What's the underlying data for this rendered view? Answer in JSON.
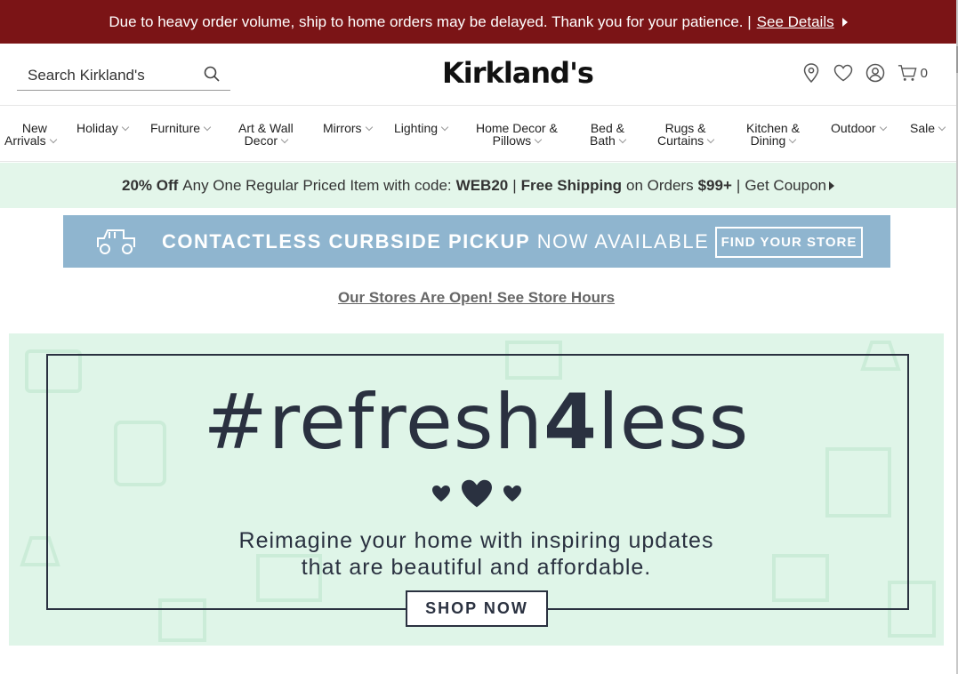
{
  "announcement": {
    "text": "Due to heavy order volume, ship to home orders may be delayed. Thank you for your patience. |",
    "link": "See Details"
  },
  "header": {
    "search_placeholder": "Search Kirkland's",
    "logo": "Kirkland's",
    "cart_count": "0"
  },
  "nav": [
    {
      "line1": "New",
      "line2": "Arrivals"
    },
    {
      "line1": "Holiday",
      "line2": ""
    },
    {
      "line1": "Furniture",
      "line2": ""
    },
    {
      "line1": "Art & Wall",
      "line2": "Decor"
    },
    {
      "line1": "Mirrors",
      "line2": ""
    },
    {
      "line1": "Lighting",
      "line2": ""
    },
    {
      "line1": "Home Decor &",
      "line2": "Pillows"
    },
    {
      "line1": "Bed &",
      "line2": "Bath"
    },
    {
      "line1": "Rugs &",
      "line2": "Curtains"
    },
    {
      "line1": "Kitchen &",
      "line2": "Dining"
    },
    {
      "line1": "Outdoor",
      "line2": ""
    },
    {
      "line1": "Sale",
      "line2": ""
    }
  ],
  "promo": {
    "discount": "20% Off",
    "item_text": "Any One Regular Priced Item with code:",
    "code": "WEB20",
    "sep1": "|",
    "free_shipping": "Free Shipping",
    "orders_text": "on Orders",
    "threshold": "$99+",
    "sep2": "|",
    "coupon_link": "Get Coupon"
  },
  "curbside": {
    "bold_text": "CONTACTLESS CURBSIDE PICKUP",
    "rest_text": "NOW AVAILABLE",
    "button": "FIND YOUR STORE"
  },
  "store_hours_link": "Our Stores Are Open! See Store Hours",
  "hero": {
    "headline_pre": "#refresh",
    "headline_num": "4",
    "headline_post": "less",
    "sub_line1": "Reimagine your home with inspiring updates",
    "sub_line2": "that are beautiful and affordable.",
    "button": "SHOP NOW"
  },
  "colors": {
    "announce_bg": "#7b1416",
    "promo_bg": "#e3f6ea",
    "curbside_bg": "#8fb5cf",
    "hero_bg": "#dff5e8",
    "hero_ink": "#2a3140"
  }
}
